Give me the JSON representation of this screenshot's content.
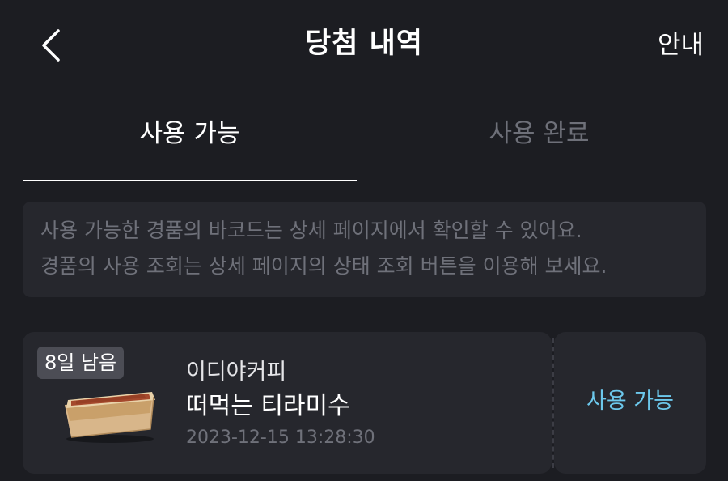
{
  "header": {
    "back_icon": "chevron-left-icon",
    "title": "당첨 내역",
    "info_label": "안내"
  },
  "tabs": [
    {
      "label": "사용 가능",
      "active": true
    },
    {
      "label": "사용 완료",
      "active": false
    }
  ],
  "notice": {
    "lines": [
      "사용 가능한 경품의 바코드는 상세 페이지에서 확인할 수 있어요.",
      "경품의 사용 조회는 상세 페이지의 상태 조회 버튼을 이용해 보세요."
    ]
  },
  "coupons": [
    {
      "days_left": "8일 남음",
      "brand": "이디야커피",
      "product": "떠먹는 티라미수",
      "date": "2023-12-15 13:28:30",
      "status": "사용 가능",
      "image_icon": "tiramisu-box-icon"
    }
  ],
  "colors": {
    "background": "#1c1d22",
    "card": "#26272d",
    "status_accent": "#6cc8ec",
    "muted_text": "#6f717a"
  }
}
